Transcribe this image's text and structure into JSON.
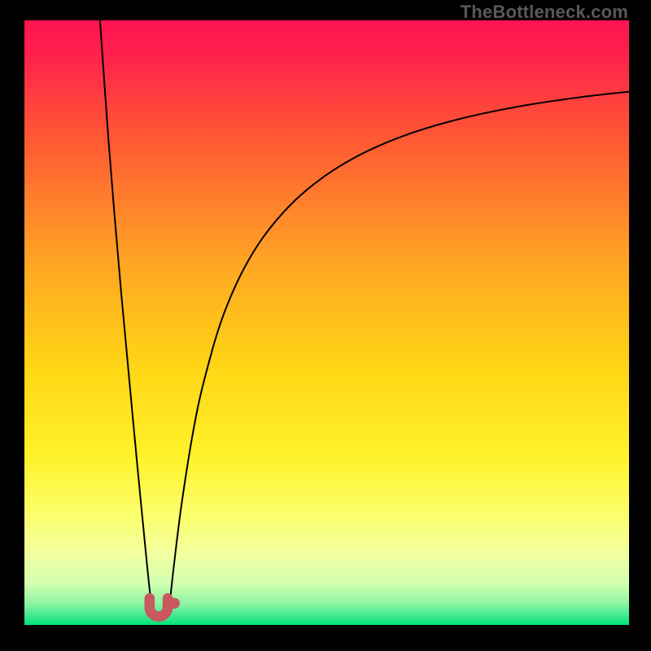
{
  "watermark": "TheBottleneck.com",
  "colors": {
    "frame": "#000000",
    "curve": "#000000",
    "marker_fill": "#c85a5f",
    "gradient_top": "#ff1452",
    "gradient_mid1": "#ff8a2b",
    "gradient_mid2": "#ffe13a",
    "gradient_mid3": "#faff77",
    "gradient_mid4": "#d4ffb0",
    "gradient_bottom": "#00e47a"
  },
  "chart_data": {
    "type": "line",
    "title": "",
    "xlabel": "",
    "ylabel": "",
    "xlim": [
      0,
      100
    ],
    "ylim": [
      0,
      100
    ],
    "legend": false,
    "grid": false,
    "series_notes": "V-shaped bottleneck curve with minimum near x≈22; left arm steep, right arm asymptotic.",
    "series": [
      {
        "name": "curve-left",
        "x": [
          12.5,
          14,
          16,
          18,
          19,
          20,
          20.5,
          21
        ],
        "values": [
          100,
          79,
          55,
          33.5,
          23,
          12.8,
          7.8,
          3.2
        ]
      },
      {
        "name": "curve-right",
        "x": [
          24,
          24.7,
          26,
          28,
          30,
          33,
          37,
          42,
          48,
          55,
          63,
          72,
          82,
          92,
          100
        ],
        "values": [
          3.2,
          9.6,
          20,
          32.5,
          41.5,
          51.5,
          60.2,
          67.3,
          73,
          77.5,
          81,
          83.7,
          85.8,
          87.3,
          88.2
        ]
      }
    ],
    "markers": [
      {
        "shape": "U",
        "x": 22.2,
        "y_bottom": 1.4,
        "y_top": 4.4,
        "width": 3.0
      },
      {
        "shape": "dot",
        "x": 24.8,
        "y": 3.6,
        "r": 0.9
      }
    ]
  }
}
